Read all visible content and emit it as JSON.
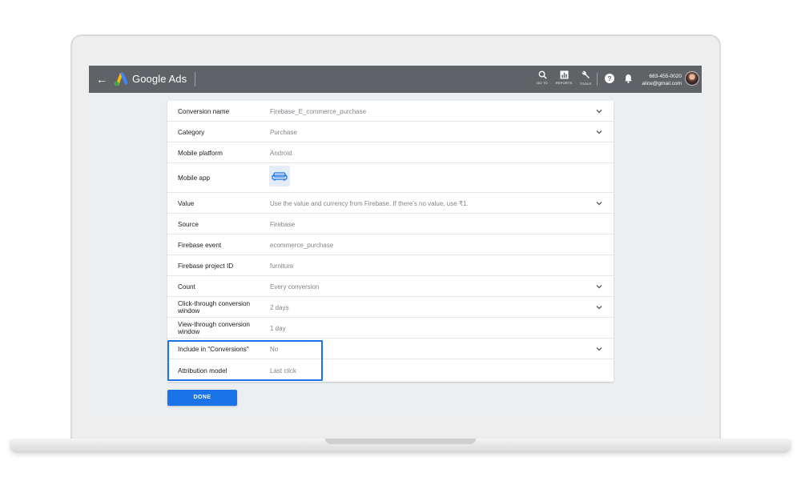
{
  "header": {
    "brand": "Google Ads",
    "tools": [
      {
        "label": "GO TO",
        "icon": "search-icon"
      },
      {
        "label": "REPORTS",
        "icon": "reports-icon"
      },
      {
        "label": "TOOLS",
        "icon": "wrench-icon"
      }
    ],
    "account": {
      "phone": "683-455-0020",
      "email": "alice@gmail.com"
    }
  },
  "form": {
    "rows": [
      {
        "label": "Conversion name",
        "value": "Firebase_E_commerce_purchase"
      },
      {
        "label": "Category",
        "value": "Purchase"
      },
      {
        "label": "Mobile platform",
        "value": "Android"
      },
      {
        "label": "Mobile app",
        "value": ""
      },
      {
        "label": "Value",
        "value": "Use the value and currency from Firebase. If there's no value, use ₹1."
      },
      {
        "label": "Source",
        "value": "Firebase"
      },
      {
        "label": "Firebase event",
        "value": "ecommerce_purchase"
      },
      {
        "label": "Firebase project ID",
        "value": "furniture"
      },
      {
        "label": "Count",
        "value": "Every conversion"
      },
      {
        "label": "Click-through conversion window",
        "value": "2 days"
      },
      {
        "label": "View-through conversion window",
        "value": "1 day"
      },
      {
        "label": "Include in \"Conversions\"",
        "value": "No"
      },
      {
        "label": "Attribution model",
        "value": "Last click"
      }
    ]
  },
  "actions": {
    "done_label": "DONE"
  },
  "colors": {
    "topbar": "#5f6368",
    "accent": "#1a73e8"
  }
}
